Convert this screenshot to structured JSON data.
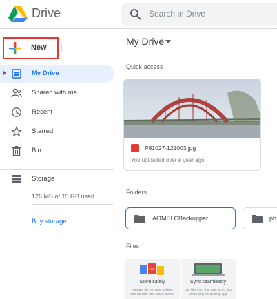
{
  "app": {
    "title": "Drive"
  },
  "search": {
    "placeholder": "Search in Drive"
  },
  "sidebar": {
    "new_label": "New",
    "items": [
      {
        "label": "My Drive",
        "icon": "my-drive-icon",
        "active": true
      },
      {
        "label": "Shared with me",
        "icon": "people-icon",
        "active": false
      },
      {
        "label": "Recent",
        "icon": "clock-icon",
        "active": false
      },
      {
        "label": "Starred",
        "icon": "star-icon",
        "active": false
      },
      {
        "label": "Bin",
        "icon": "trash-icon",
        "active": false
      },
      {
        "label": "Storage",
        "icon": "storage-icon",
        "active": false
      }
    ],
    "storage_used": "126 MB of 15 GB used",
    "storage_fraction": 0.0084,
    "buy_storage": "Buy storage"
  },
  "main": {
    "title": "My Drive",
    "quick_access_label": "Quick access",
    "quick_access": {
      "file_name": "P81027-121003.jpg",
      "subtitle": "You uploaded over a year ago"
    },
    "folders_label": "Folders",
    "folders": [
      {
        "name": "AOMEI CBackupper"
      },
      {
        "name": "ph"
      }
    ],
    "files_label": "Files",
    "files": [
      {
        "title": "Store safely",
        "desc": "Add any file you want to keep safe with the New button above."
      },
      {
        "title": "Sync seamlessly",
        "desc": "Get files from your Mac or PC into Drive using the desktop app."
      }
    ]
  },
  "colors": {
    "accent": "#1a73e8",
    "highlight_border": "#e53935",
    "active_bg": "#e8f0fe"
  }
}
